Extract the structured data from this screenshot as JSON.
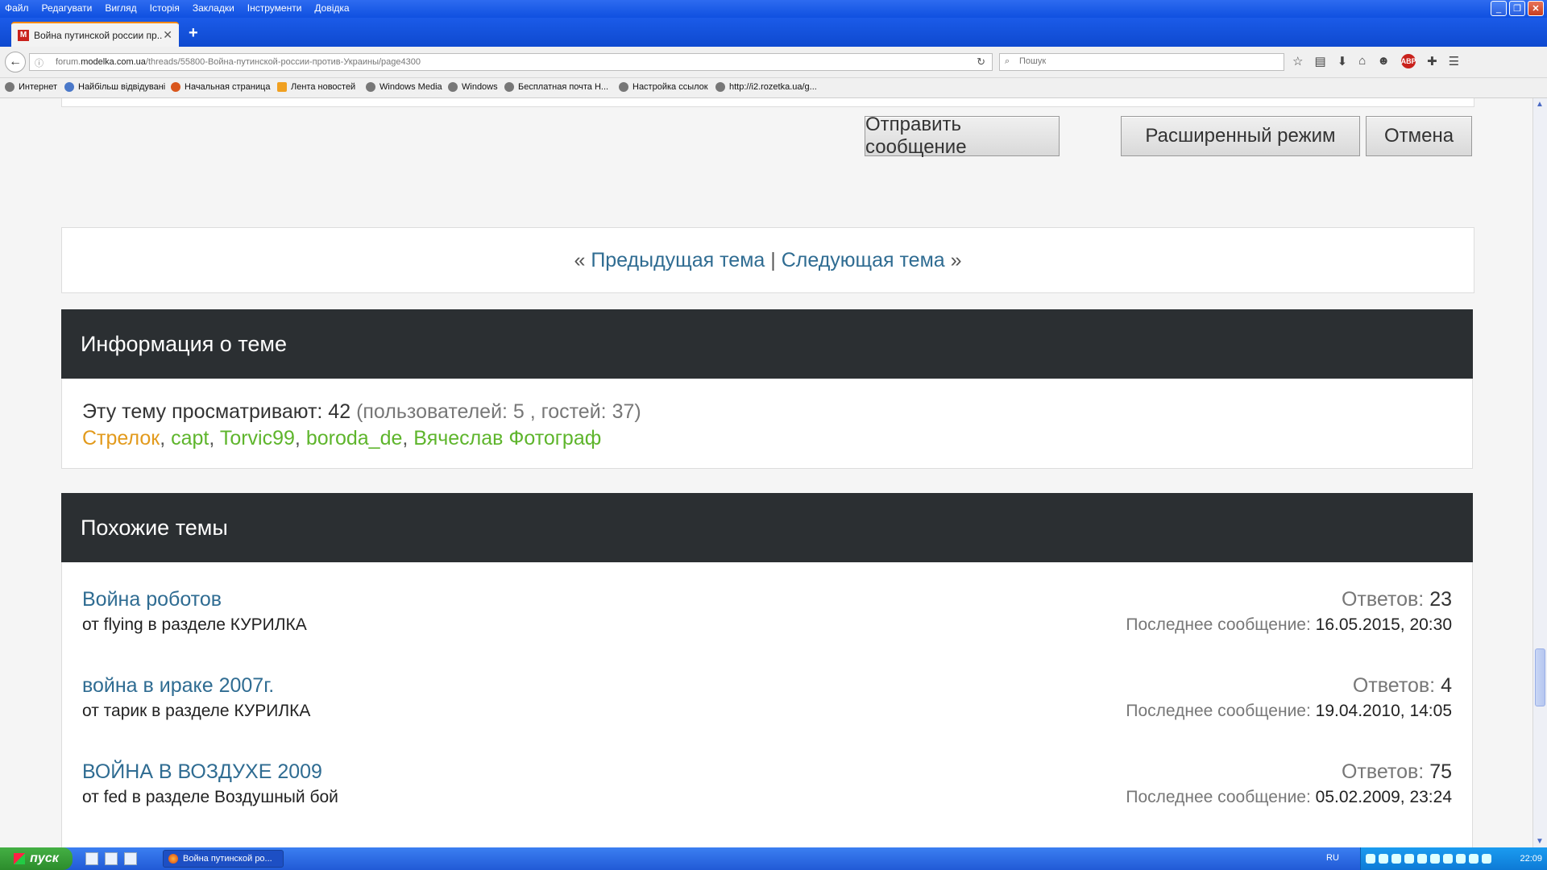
{
  "menubar": {
    "items": [
      "Файл",
      "Редагувати",
      "Вигляд",
      "Історія",
      "Закладки",
      "Інструменти",
      "Довідка"
    ]
  },
  "tab": {
    "title": "Война путинской россии пр...",
    "favicon": "М"
  },
  "address": {
    "url_prefix": "forum.",
    "url_domain": "modelka.com.ua",
    "url_path": "/threads/55800-Война-путинской-россии-против-Украины/page4300"
  },
  "search": {
    "placeholder": "Пошук"
  },
  "bookmarks": [
    "Интернет",
    "Найбільш відвідувані",
    "Начальная страница",
    "Лента новостей",
    "Windows Media",
    "Windows",
    "Бесплатная почта Н...",
    "Настройка ссылок",
    "http://i2.rozetka.ua/g..."
  ],
  "reply_buttons": {
    "send": "Отправить сообщение",
    "advanced": "Расширенный режим",
    "cancel": "Отмена"
  },
  "thread_nav": {
    "prefix": "«",
    "prev": "Предыдущая тема",
    "sep": "|",
    "next": "Следующая тема",
    "suffix": "»"
  },
  "thread_info": {
    "heading": "Информация о теме",
    "viewers_label": "Эту тему просматривают:",
    "viewers_count": "42",
    "viewers_breakdown": "(пользователей: 5 , гостей: 37)",
    "users": [
      {
        "name": "Стрелок",
        "color": "#e29a1c"
      },
      {
        "name": "capt",
        "color": "#5eb52c"
      },
      {
        "name": "Torvic99",
        "color": "#5eb52c"
      },
      {
        "name": "boroda_de",
        "color": "#5eb52c"
      },
      {
        "name": "Вячеслав Фотограф",
        "color": "#5eb52c"
      }
    ],
    "separator": ","
  },
  "similar": {
    "heading": "Похожие темы",
    "replies_label": "Ответов:",
    "last_label": "Последнее сообщение:",
    "threads": [
      {
        "title": "Война роботов",
        "meta": "от flying в разделе КУРИЛКА",
        "replies": "23",
        "last": "16.05.2015, 20:30"
      },
      {
        "title": "война в ираке 2007г.",
        "meta": "от тарик в разделе КУРИЛКА",
        "replies": "4",
        "last": "19.04.2010, 14:05"
      },
      {
        "title": "ВОЙНА В ВОЗДУХЕ 2009",
        "meta": "от fed в разделе Воздушный бой",
        "replies": "75",
        "last": "05.02.2009, 23:24"
      }
    ]
  },
  "taskbar": {
    "start": "пуск",
    "window": "Война путинской ро...",
    "lang": "RU",
    "clock": "22:09"
  }
}
